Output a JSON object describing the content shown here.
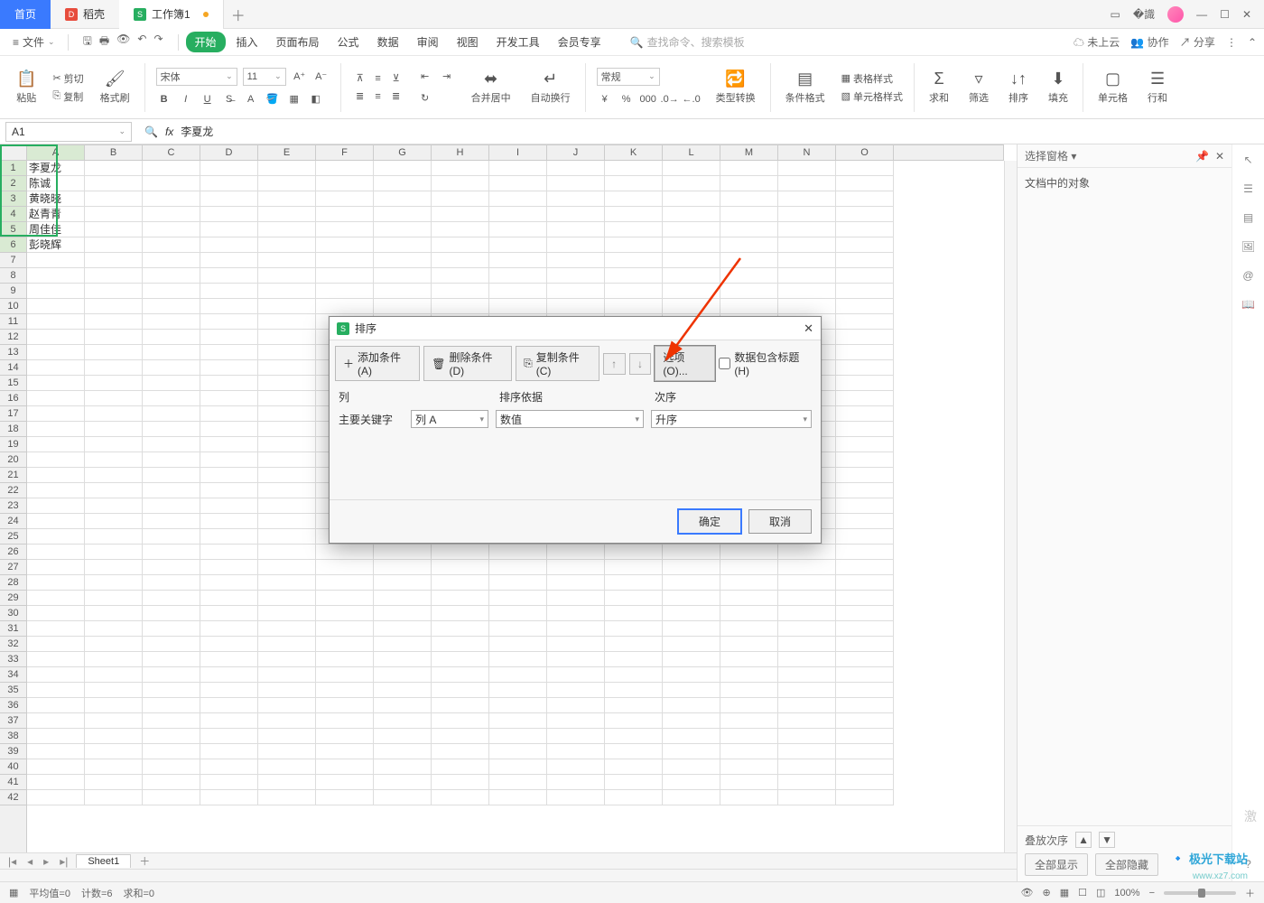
{
  "tabs": {
    "home": "首页",
    "dk": "稻壳",
    "workbook": "工作簿1"
  },
  "menu": {
    "file": "文件",
    "items": [
      "开始",
      "插入",
      "页面布局",
      "公式",
      "数据",
      "审阅",
      "视图",
      "开发工具",
      "会员专享"
    ],
    "search_hint": "查找命令、搜索模板",
    "cloud": "未上云",
    "coop": "协作",
    "share": "分享"
  },
  "ribbon": {
    "paste": "粘贴",
    "cut": "剪切",
    "copy": "复制",
    "fmtpaint": "格式刷",
    "font": "宋体",
    "size": "11",
    "mergecenter": "合并居中",
    "wrap": "自动换行",
    "numfmt": "常规",
    "typeconv": "类型转换",
    "condfmt": "条件格式",
    "tablestyle": "表格样式",
    "cellstyle": "单元格样式",
    "sum": "求和",
    "filter": "筛选",
    "sort": "排序",
    "fill": "填充",
    "cell": "单元格",
    "row": "行和"
  },
  "namebox": "A1",
  "formula": "李夏龙",
  "columns": [
    "A",
    "B",
    "C",
    "D",
    "E",
    "F",
    "G",
    "H",
    "I",
    "J",
    "K",
    "L",
    "M",
    "N",
    "O"
  ],
  "row_count": 42,
  "data": [
    "李夏龙",
    "陈诚",
    "黄晓晓",
    "赵青青",
    "周佳佳",
    "彭晓辉"
  ],
  "sheet": "Sheet1",
  "rightpane": {
    "title": "选择窗格",
    "section": "文档中的对象",
    "stack": "叠放次序",
    "showall": "全部显示",
    "hideall": "全部隐藏"
  },
  "dialog": {
    "title": "排序",
    "add": "添加条件(A)",
    "del": "删除条件(D)",
    "copy": "复制条件(C)",
    "options": "选项(O)...",
    "header": "数据包含标题(H)",
    "col_h": "列",
    "by_h": "排序依据",
    "order_h": "次序",
    "keylabel": "主要关键字",
    "col": "列 A",
    "by": "数值",
    "order": "升序",
    "ok": "确定",
    "cancel": "取消"
  },
  "status": {
    "avg": "平均值=0",
    "count": "计数=6",
    "sum": "求和=0",
    "zoom": "100%"
  },
  "watermark": {
    "site": "极光下载站",
    "url": "www.xz7.com",
    "act": "激"
  }
}
